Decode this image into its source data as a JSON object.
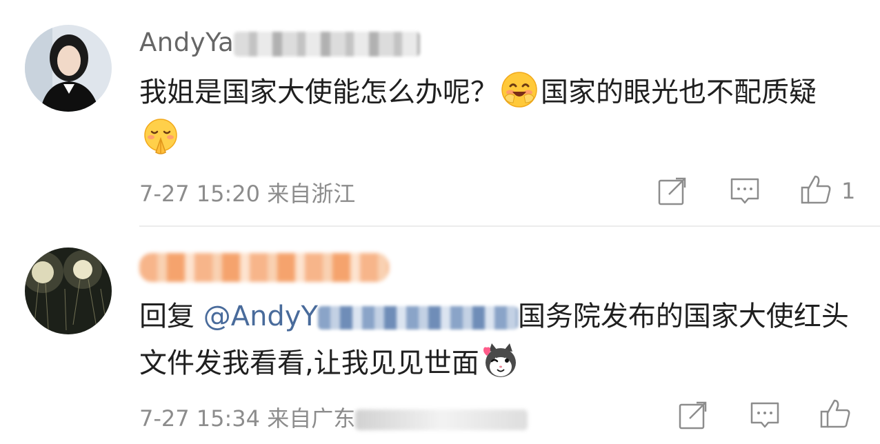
{
  "comments": [
    {
      "username_visible": "AndyYa",
      "text_before_emoji": "我姐是国家大使能怎么办呢？",
      "emoji_1": "smiling-blush-emoji",
      "text_after_emoji": "国家的眼光也不配质疑",
      "emoji_2": "pleading-hands-emoji",
      "timestamp": "7-27 15:20",
      "location": "来自浙江",
      "like_count": "1"
    },
    {
      "reply_prefix": "回复",
      "mention_visible": "@AndyY",
      "text_after_mention": "国务院发布的国家大使红头文件发我看看,让我见见世面",
      "emoji": "cat-heart-emoji",
      "timestamp": "7-27 15:34",
      "location_visible": "来自广东"
    }
  ],
  "colors": {
    "username": "#666666",
    "body_text": "#1f1f1f",
    "mention": "#496b9b",
    "meta": "#8c8c8c",
    "divider": "#ececec"
  },
  "icons": [
    "share-icon",
    "comment-icon",
    "like-icon"
  ]
}
